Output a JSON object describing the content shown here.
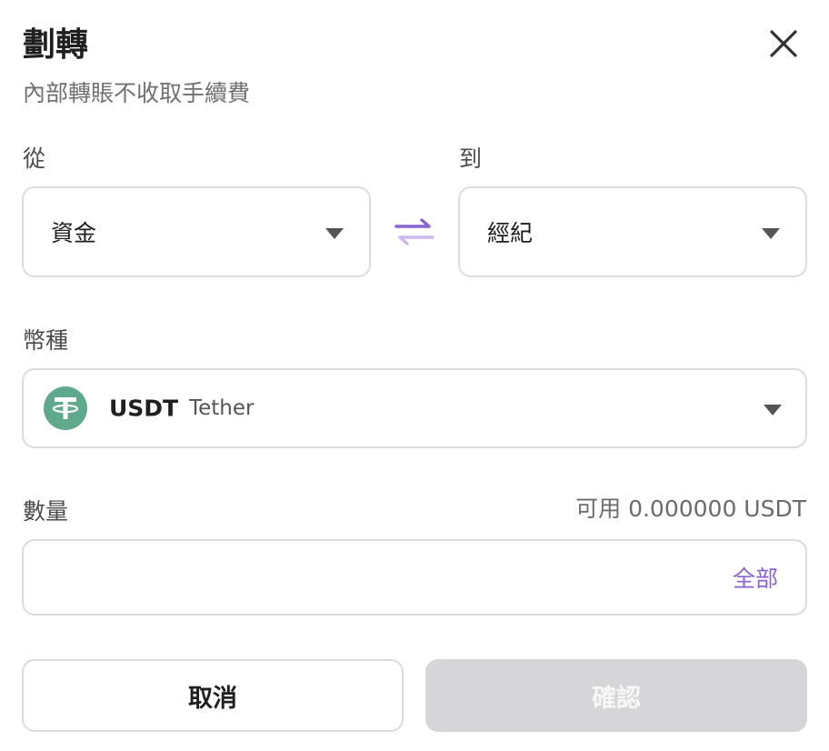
{
  "dialog": {
    "title": "劃轉",
    "subtitle": "內部轉賬不收取手續費"
  },
  "from": {
    "label": "從",
    "value": "資金"
  },
  "to": {
    "label": "到",
    "value": "經紀"
  },
  "currency": {
    "label": "幣種",
    "symbol": "USDT",
    "name": "Tether",
    "icon": "tether-icon",
    "icon_color": "#5fa98c"
  },
  "amount": {
    "label": "數量",
    "available": "可用 0.000000 USDT",
    "value": "",
    "max_label": "全部"
  },
  "actions": {
    "cancel_label": "取消",
    "confirm_label": "確認"
  },
  "colors": {
    "accent": "#8a63d2",
    "disabled_button": "#d6d6d8"
  }
}
